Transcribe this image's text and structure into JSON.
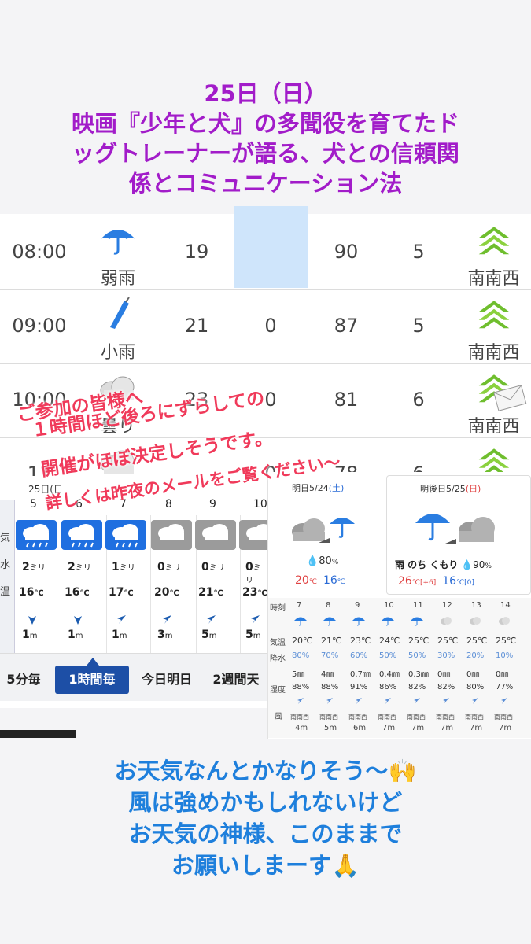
{
  "title": {
    "line1": "25日（日）",
    "line2": "映画『少年と犬』の多聞役を育てたド",
    "line3": "ッグトレーナーが語る、犬との信頼関",
    "line4": "係とコミュニケーション法"
  },
  "hourly": {
    "rows": [
      {
        "time": "08:00",
        "weather": "弱雨",
        "temp": "19",
        "precip": "2",
        "humidity": "90",
        "wind": "5",
        "dir": "南南西",
        "icon": "umbrella-icon"
      },
      {
        "time": "09:00",
        "weather": "小雨",
        "temp": "21",
        "precip": "0",
        "humidity": "87",
        "wind": "5",
        "dir": "南南西",
        "icon": "closed-umbrella-icon"
      },
      {
        "time": "10:00",
        "weather": "曇り",
        "temp": "23",
        "precip": "0",
        "humidity": "81",
        "wind": "6",
        "dir": "南南西",
        "icon": "cloud-icon"
      },
      {
        "time": "11",
        "weather": "",
        "temp": "",
        "precip": "0",
        "humidity": "78",
        "wind": "6",
        "dir": "",
        "icon": "cloud-icon"
      }
    ]
  },
  "overlay": {
    "line1": "ご参加の皆様へ",
    "line2": "１時間ほど後ろにずらしての",
    "line3": "開催がほぼ決定しそうです。",
    "line4": "詳しくは昨夜のメールをご覧ください〜"
  },
  "left_panel": {
    "date_label": "25日(日",
    "hours": [
      "5",
      "6",
      "7",
      "8",
      "9",
      "10"
    ],
    "row_labels": [
      "気",
      "水",
      "温"
    ],
    "precip": [
      "2",
      "2",
      "1",
      "0",
      "0",
      "0"
    ],
    "precip_unit": "ミリ",
    "temps": [
      "16",
      "16",
      "17",
      "20",
      "21",
      "23"
    ],
    "temp_unit": "℃",
    "wind": [
      "1",
      "1",
      "1",
      "3",
      "5",
      "5"
    ],
    "wind_unit": "m",
    "tabs": [
      "5分毎",
      "1時間毎",
      "今日明日",
      "2週間天"
    ]
  },
  "right_panel": {
    "tomorrow": {
      "label": "明日",
      "date": "5/24",
      "dow": "(土)",
      "rain": "80",
      "unit": "%",
      "high": "20",
      "low": "16",
      "deg": "℃"
    },
    "dayafter": {
      "label": "明後日",
      "date": "5/25",
      "dow": "(日)",
      "desc": "雨 のち くもり",
      "rain": "90",
      "unit": "%",
      "high": "26",
      "high_diff": "[+6]",
      "low": "16",
      "low_diff": "[0]",
      "deg": "℃"
    },
    "hours_label": "時刻",
    "hours": [
      "7",
      "8",
      "9",
      "10",
      "11",
      "12",
      "13",
      "14"
    ],
    "labels": {
      "temp": "気温",
      "prob": "降水",
      "humidity": "湿度",
      "wind": "風"
    },
    "temps": [
      "20℃",
      "21℃",
      "23℃",
      "24℃",
      "25℃",
      "25℃",
      "25℃",
      "25℃"
    ],
    "probs": [
      "80%",
      "70%",
      "60%",
      "50%",
      "50%",
      "30%",
      "20%",
      "10%"
    ],
    "amounts": [
      "5㎜",
      "4㎜",
      "0.7㎜",
      "0.4㎜",
      "0.3㎜",
      "0㎜",
      "0㎜",
      "0㎜"
    ],
    "humidity": [
      "88%",
      "88%",
      "91%",
      "86%",
      "82%",
      "82%",
      "80%",
      "77%"
    ],
    "wind_dir": [
      "南南西",
      "南南西",
      "南南西",
      "南南西",
      "南南西",
      "南南西",
      "南南西",
      "南南西"
    ],
    "wind_speed": [
      "4m",
      "5m",
      "6m",
      "7m",
      "7m",
      "7m",
      "7m",
      "7m"
    ]
  },
  "bottom": {
    "line1": "お天気なんとかなりそう〜🙌",
    "line2": "風は強めかもしれないけど",
    "line3": "お天気の神様、このままで",
    "line4": "お願いしまーす🙏"
  },
  "colors": {
    "title": "#a21cc9",
    "red_text": "#f03a5a",
    "blue_text": "#1e7fdc",
    "rain_box": "#1f6fe0",
    "cloud_box": "#9b9b9b"
  }
}
